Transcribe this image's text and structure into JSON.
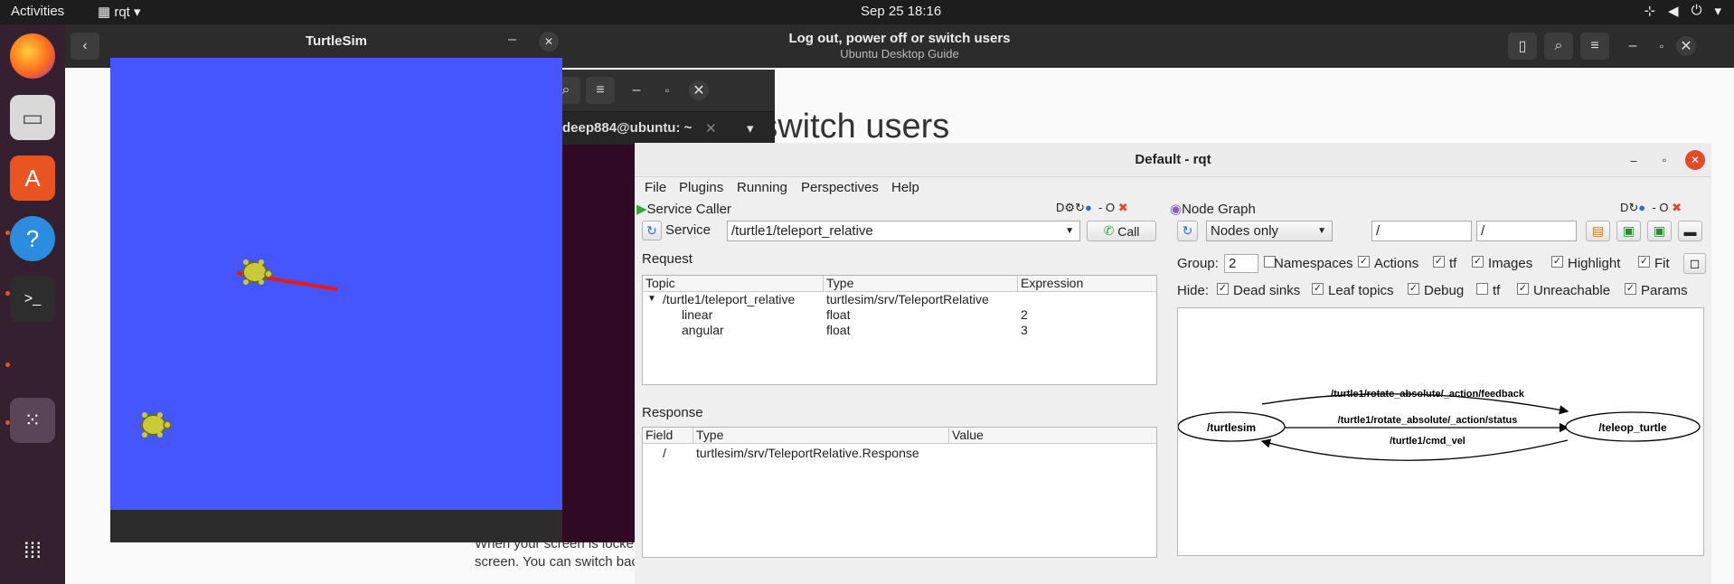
{
  "topbar": {
    "activities": "Activities",
    "app_name": "rqt",
    "clock": "Sep 25  18:16"
  },
  "help": {
    "title": "Log out, power off or switch users",
    "subtitle": "Ubuntu Desktop Guide",
    "heading_fragment": "r switch users",
    "body_line1": "When your screen is locke",
    "body_line2": "screen. You can switch bac"
  },
  "terminal": {
    "tab_label": "deep884@ubuntu: ~"
  },
  "turtlesim": {
    "title": "TurtleSim",
    "background": "#4556ff"
  },
  "rqt": {
    "title": "Default - rqt",
    "menu": [
      "File",
      "Plugins",
      "Running",
      "Perspectives",
      "Help"
    ],
    "service_caller": {
      "title": "Service Caller",
      "service_label": "Service",
      "service_value": "/turtle1/teleport_relative",
      "call_label": "Call",
      "request_label": "Request",
      "request_columns": [
        "Topic",
        "Type",
        "Expression"
      ],
      "request_rows": [
        {
          "topic": "/turtle1/teleport_relative",
          "type": "turtlesim/srv/TeleportRelative",
          "expr": ""
        },
        {
          "topic": "linear",
          "type": "float",
          "expr": "2"
        },
        {
          "topic": "angular",
          "type": "float",
          "expr": "3"
        }
      ],
      "response_label": "Response",
      "response_columns": [
        "Field",
        "Type",
        "Value"
      ],
      "response_rows": [
        {
          "field": "/",
          "type": "turtlesim/srv/TeleportRelative.Response",
          "value": ""
        }
      ]
    },
    "node_graph": {
      "title": "Node Graph",
      "mode": "Nodes only",
      "filter1": "/",
      "filter2": "/",
      "group_label": "Group:",
      "group_value": "2",
      "hide_label": "Hide:",
      "options_row1": [
        {
          "label": "Namespaces",
          "checked": false
        },
        {
          "label": "Actions",
          "checked": true
        },
        {
          "label": "tf",
          "checked": true
        },
        {
          "label": "Images",
          "checked": true
        },
        {
          "label": "Highlight",
          "checked": true
        },
        {
          "label": "Fit",
          "checked": true
        }
      ],
      "options_row2": [
        {
          "label": "Dead sinks",
          "checked": true
        },
        {
          "label": "Leaf topics",
          "checked": true
        },
        {
          "label": "Debug",
          "checked": true
        },
        {
          "label": "tf",
          "checked": false
        },
        {
          "label": "Unreachable",
          "checked": true
        },
        {
          "label": "Params",
          "checked": true
        }
      ],
      "nodes": [
        "/turtlesim",
        "/teleop_turtle"
      ],
      "edges": [
        "/turtle1/rotate_absolute/_action/feedback",
        "/turtle1/rotate_absolute/_action/status",
        "/turtle1/cmd_vel"
      ]
    }
  }
}
